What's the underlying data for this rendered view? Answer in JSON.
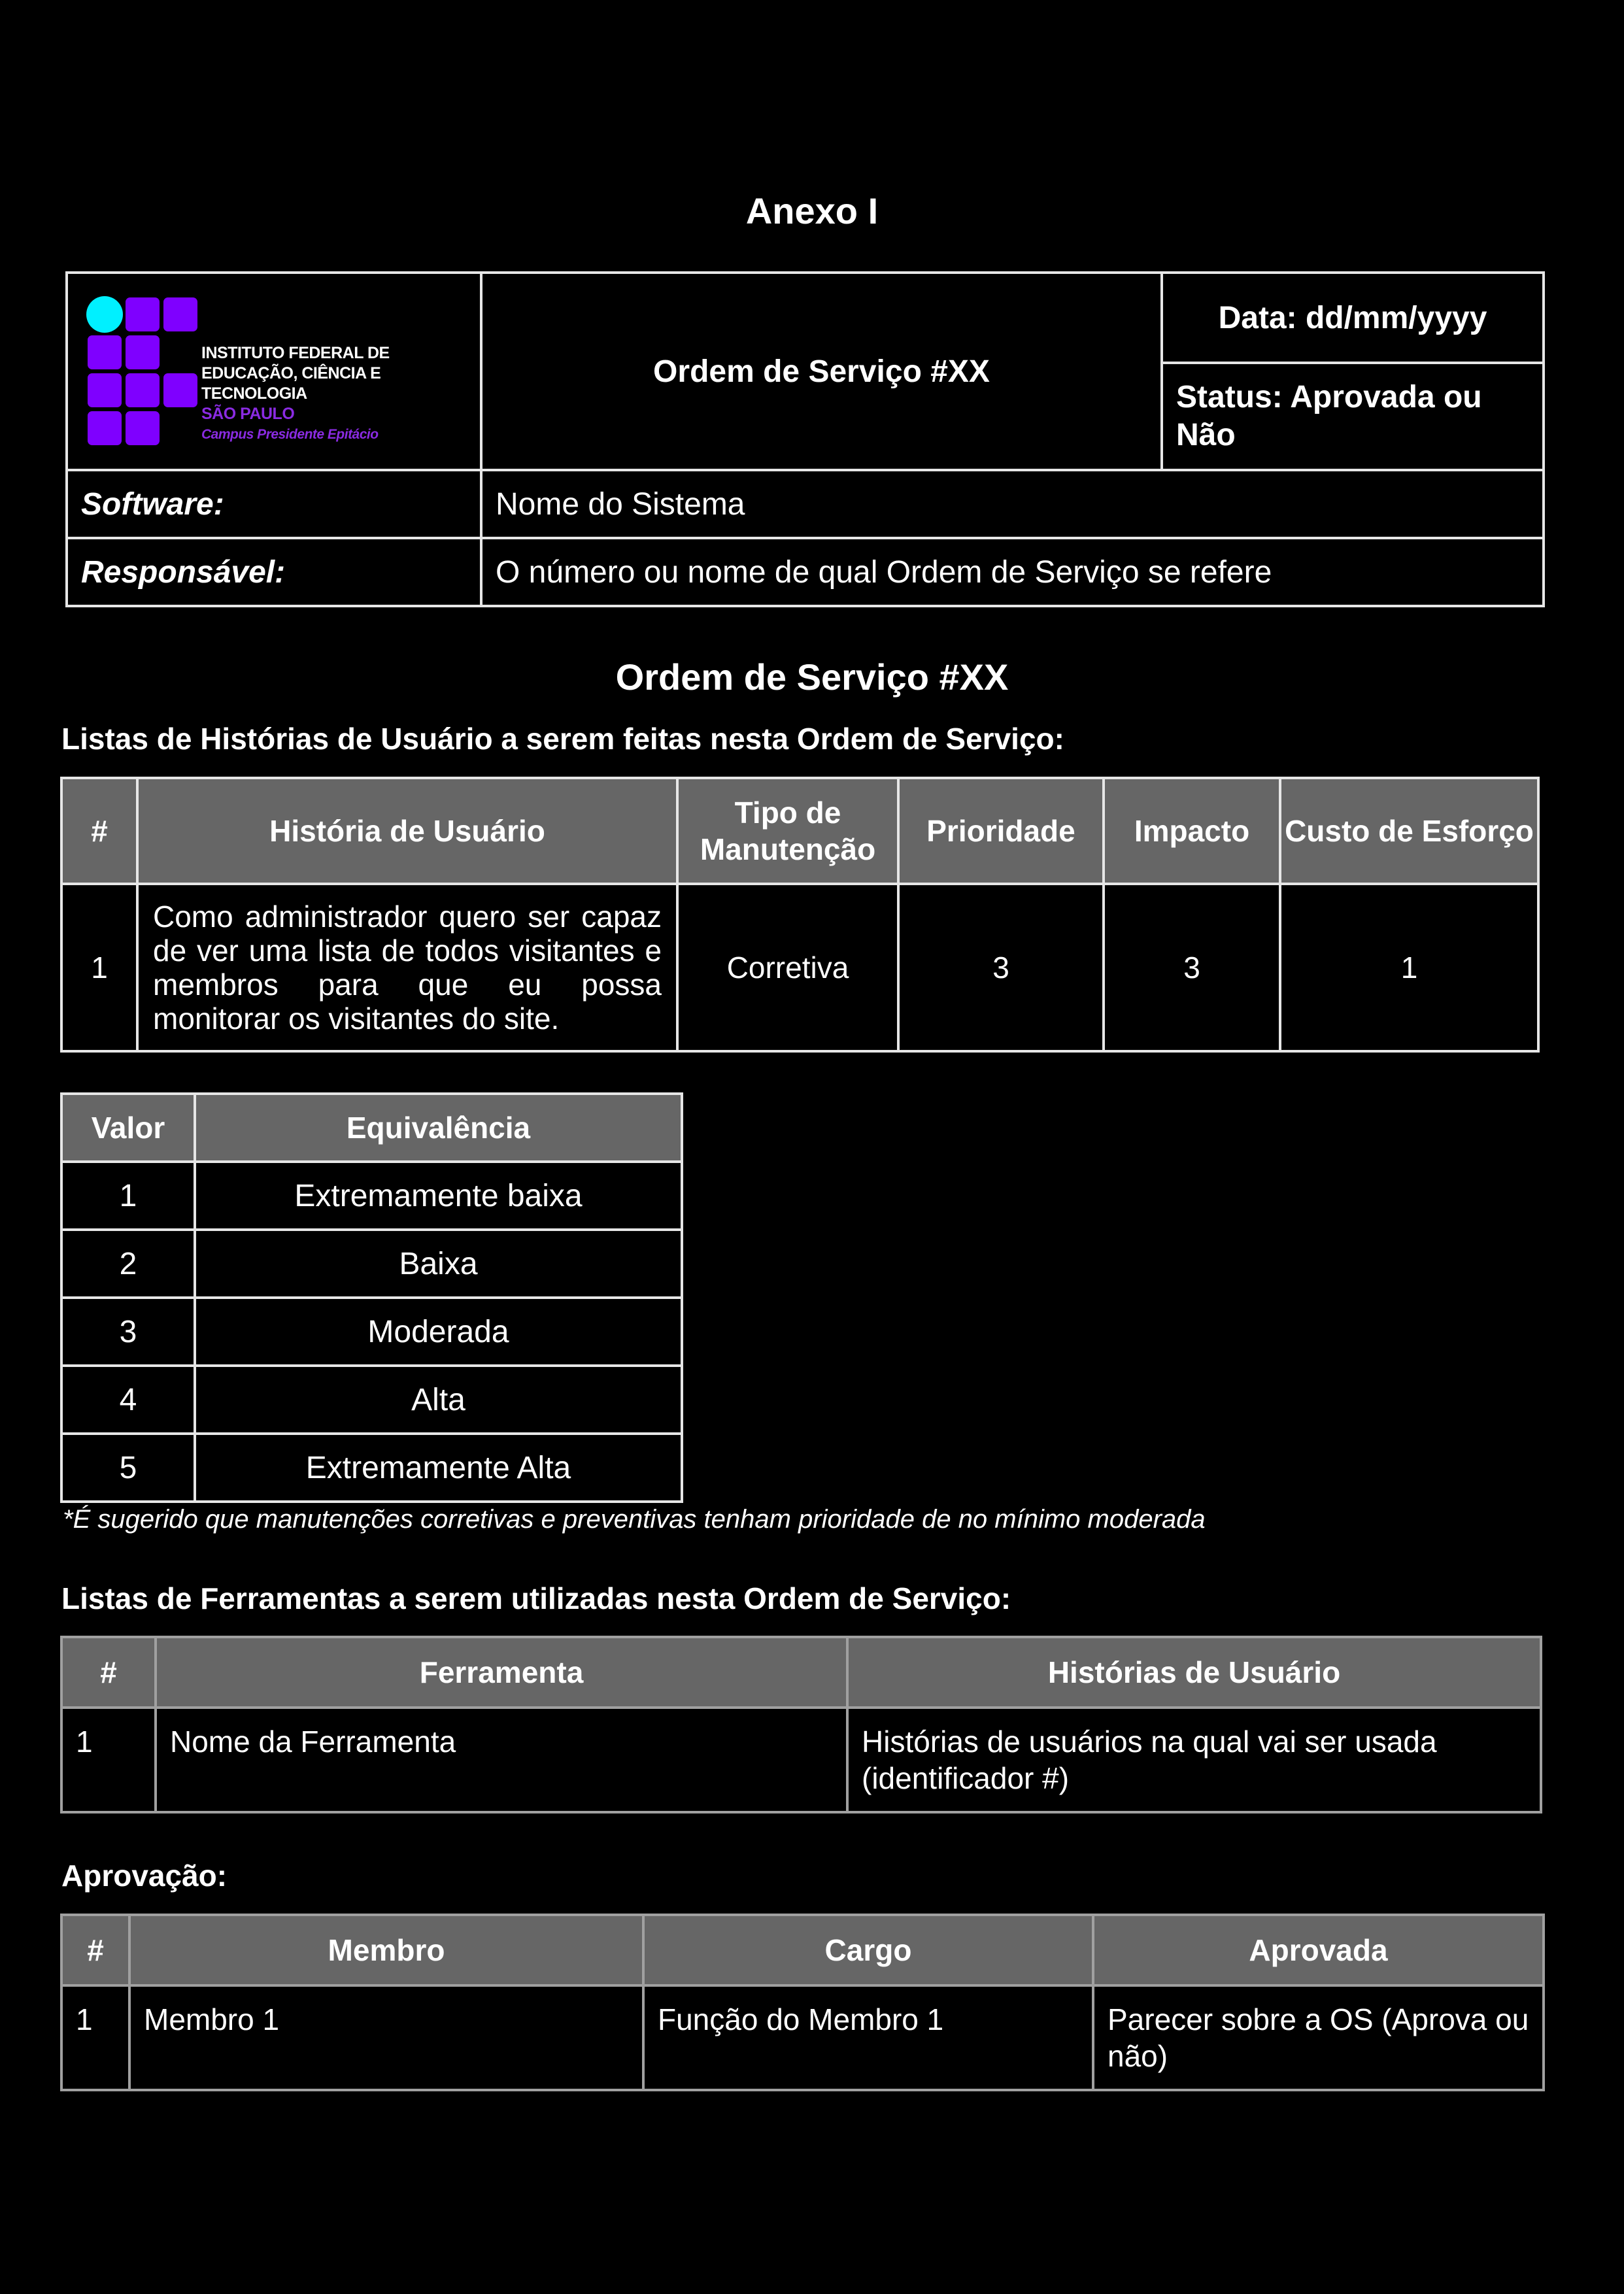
{
  "page": {
    "annex_title": "Anexo I"
  },
  "logo": {
    "line1": "INSTITUTO FEDERAL DE",
    "line2": "EDUCAÇÃO, CIÊNCIA E TECNOLOGIA",
    "line3": "SÃO PAULO",
    "line4": "Campus Presidente Epitácio",
    "colors": {
      "circle": "#00f0ff",
      "squares": "#7f00ff"
    }
  },
  "header": {
    "os_title": "Ordem de Serviço #XX",
    "date": "Data: dd/mm/yyyy",
    "status": "Status: Aprovada ou Não",
    "software_label": "Software:",
    "software_value": "Nome do Sistema",
    "responsible_label": "Responsável:",
    "responsible_value": "O número ou nome de qual Ordem de Serviço se refere"
  },
  "section": {
    "title": "Ordem de Serviço #XX",
    "stories_heading": "Listas de Histórias de Usuário a serem feitas nesta Ordem de Serviço:",
    "tools_heading": "Listas de Ferramentas a serem utilizadas nesta Ordem de Serviço:",
    "approval_heading": "Aprovação:"
  },
  "stories_table": {
    "headers": [
      "#",
      "História de Usuário",
      "Tipo de Manutenção",
      "Prioridade",
      "Impacto",
      "Custo de Esforço"
    ],
    "rows": [
      {
        "num": "1",
        "story": "Como administrador quero ser capaz de ver uma lista de todos visitantes e membros para que eu possa monitorar os visitantes do site.",
        "type": "Corretiva",
        "priority": "3",
        "impact": "3",
        "effort": "1"
      }
    ]
  },
  "scale_table": {
    "headers": [
      "Valor",
      "Equivalência"
    ],
    "rows": [
      {
        "value": "1",
        "label": "Extremamente baixa"
      },
      {
        "value": "2",
        "label": "Baixa"
      },
      {
        "value": "3",
        "label": "Moderada"
      },
      {
        "value": "4",
        "label": "Alta"
      },
      {
        "value": "5",
        "label": "Extremamente Alta"
      }
    ],
    "footnote": "*É sugerido que manutenções corretivas e preventivas tenham prioridade de no mínimo moderada"
  },
  "tools_table": {
    "headers": [
      "#",
      "Ferramenta",
      "Histórias de Usuário"
    ],
    "rows": [
      {
        "num": "1",
        "tool": "Nome da Ferramenta",
        "stories": "Histórias de usuários na qual vai ser usada (identificador #)"
      }
    ]
  },
  "approval_table": {
    "headers": [
      "#",
      "Membro",
      "Cargo",
      "Aprovada"
    ],
    "rows": [
      {
        "num": "1",
        "member": "Membro 1",
        "role": "Função do Membro 1",
        "approved": "Parecer sobre a OS (Aprova ou não)"
      }
    ]
  },
  "colors": {
    "background": "#000000",
    "text": "#ffffff",
    "table_header": "#666666",
    "border": "#e6e6e6"
  }
}
